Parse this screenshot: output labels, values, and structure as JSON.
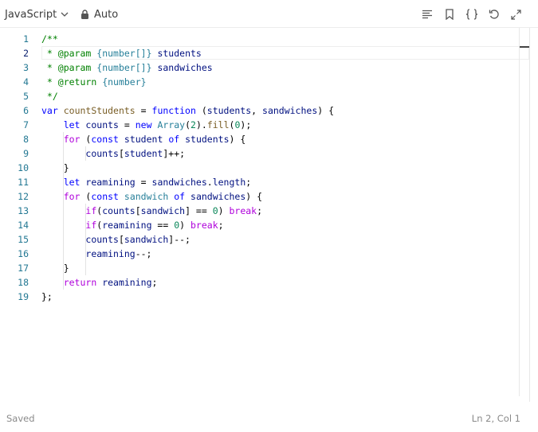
{
  "toolbar": {
    "language": "JavaScript",
    "mode": "Auto",
    "icons": [
      "format-icon",
      "bookmark-icon",
      "braces-icon",
      "reset-icon",
      "expand-icon"
    ]
  },
  "editor": {
    "lines": [
      {
        "n": "1"
      },
      {
        "n": "2"
      },
      {
        "n": "3"
      },
      {
        "n": "4"
      },
      {
        "n": "5"
      },
      {
        "n": "6"
      },
      {
        "n": "7"
      },
      {
        "n": "8"
      },
      {
        "n": "9"
      },
      {
        "n": "10"
      },
      {
        "n": "11"
      },
      {
        "n": "12"
      },
      {
        "n": "13"
      },
      {
        "n": "14"
      },
      {
        "n": "15"
      },
      {
        "n": "16"
      },
      {
        "n": "17"
      },
      {
        "n": "18"
      },
      {
        "n": "19"
      }
    ],
    "code": [
      [
        [
          "c-com",
          "/**"
        ]
      ],
      [
        [
          "c-com",
          " * "
        ],
        [
          "c-tag",
          "@param"
        ],
        [
          "c-op",
          " "
        ],
        [
          "c-type",
          "{number[]}"
        ],
        [
          "c-op",
          " "
        ],
        [
          "c-var",
          "students"
        ]
      ],
      [
        [
          "c-com",
          " * "
        ],
        [
          "c-tag",
          "@param"
        ],
        [
          "c-op",
          " "
        ],
        [
          "c-type",
          "{number[]}"
        ],
        [
          "c-op",
          " "
        ],
        [
          "c-var",
          "sandwiches"
        ]
      ],
      [
        [
          "c-com",
          " * "
        ],
        [
          "c-tag",
          "@return"
        ],
        [
          "c-op",
          " "
        ],
        [
          "c-type",
          "{number}"
        ]
      ],
      [
        [
          "c-com",
          " */"
        ]
      ],
      [
        [
          "c-kw",
          "var"
        ],
        [
          "c-op",
          " "
        ],
        [
          "c-fn",
          "countStudents"
        ],
        [
          "c-op",
          " = "
        ],
        [
          "c-kw",
          "function"
        ],
        [
          "c-op",
          " ("
        ],
        [
          "c-var",
          "students"
        ],
        [
          "c-op",
          ", "
        ],
        [
          "c-var",
          "sandwiches"
        ],
        [
          "c-op",
          ") {"
        ]
      ],
      [
        [
          "c-op",
          "    "
        ],
        [
          "c-kw",
          "let"
        ],
        [
          "c-op",
          " "
        ],
        [
          "c-var",
          "counts"
        ],
        [
          "c-op",
          " = "
        ],
        [
          "c-kw",
          "new"
        ],
        [
          "c-op",
          " "
        ],
        [
          "c-cls",
          "Array"
        ],
        [
          "c-op",
          "("
        ],
        [
          "c-num",
          "2"
        ],
        [
          "c-op",
          ")."
        ],
        [
          "c-fn",
          "fill"
        ],
        [
          "c-op",
          "("
        ],
        [
          "c-num",
          "0"
        ],
        [
          "c-op",
          ");"
        ]
      ],
      [
        [
          "c-op",
          "    "
        ],
        [
          "c-ctl",
          "for"
        ],
        [
          "c-op",
          " ("
        ],
        [
          "c-kw",
          "const"
        ],
        [
          "c-op",
          " "
        ],
        [
          "c-var",
          "student"
        ],
        [
          "c-op",
          " "
        ],
        [
          "c-kw",
          "of"
        ],
        [
          "c-op",
          " "
        ],
        [
          "c-var",
          "students"
        ],
        [
          "c-op",
          ") {"
        ]
      ],
      [
        [
          "c-op",
          "        "
        ],
        [
          "c-var",
          "counts"
        ],
        [
          "c-op",
          "["
        ],
        [
          "c-var",
          "student"
        ],
        [
          "c-op",
          "]++;"
        ]
      ],
      [
        [
          "c-op",
          "    }"
        ]
      ],
      [
        [
          "c-op",
          "    "
        ],
        [
          "c-kw",
          "let"
        ],
        [
          "c-op",
          " "
        ],
        [
          "c-var",
          "reamining"
        ],
        [
          "c-op",
          " = "
        ],
        [
          "c-var",
          "sandwiches"
        ],
        [
          "c-op",
          "."
        ],
        [
          "c-var",
          "length"
        ],
        [
          "c-op",
          ";"
        ]
      ],
      [
        [
          "c-op",
          "    "
        ],
        [
          "c-ctl",
          "for"
        ],
        [
          "c-op",
          " ("
        ],
        [
          "c-kw",
          "const"
        ],
        [
          "c-op",
          " "
        ],
        [
          "c-cls",
          "sandwich"
        ],
        [
          "c-op",
          " "
        ],
        [
          "c-kw",
          "of"
        ],
        [
          "c-op",
          " "
        ],
        [
          "c-var",
          "sandwiches"
        ],
        [
          "c-op",
          ") {"
        ]
      ],
      [
        [
          "c-op",
          "        "
        ],
        [
          "c-ctl",
          "if"
        ],
        [
          "c-op",
          "("
        ],
        [
          "c-var",
          "counts"
        ],
        [
          "c-op",
          "["
        ],
        [
          "c-var",
          "sandwich"
        ],
        [
          "c-op",
          "] == "
        ],
        [
          "c-num",
          "0"
        ],
        [
          "c-op",
          ") "
        ],
        [
          "c-ctl",
          "break"
        ],
        [
          "c-op",
          ";"
        ]
      ],
      [
        [
          "c-op",
          "        "
        ],
        [
          "c-ctl",
          "if"
        ],
        [
          "c-op",
          "("
        ],
        [
          "c-var",
          "reamining"
        ],
        [
          "c-op",
          " == "
        ],
        [
          "c-num",
          "0"
        ],
        [
          "c-op",
          ") "
        ],
        [
          "c-ctl",
          "break"
        ],
        [
          "c-op",
          ";"
        ]
      ],
      [
        [
          "c-op",
          "        "
        ],
        [
          "c-var",
          "counts"
        ],
        [
          "c-op",
          "["
        ],
        [
          "c-var",
          "sandwich"
        ],
        [
          "c-op",
          "]--;"
        ]
      ],
      [
        [
          "c-op",
          "        "
        ],
        [
          "c-var",
          "reamining"
        ],
        [
          "c-op",
          "--;"
        ]
      ],
      [
        [
          "c-op",
          "    }"
        ]
      ],
      [
        [
          "c-op",
          "    "
        ],
        [
          "c-ctl",
          "return"
        ],
        [
          "c-op",
          " "
        ],
        [
          "c-var",
          "reamining"
        ],
        [
          "c-op",
          ";"
        ]
      ],
      [
        [
          "c-op",
          "};"
        ]
      ]
    ],
    "active_line": 2
  },
  "status": {
    "left": "Saved",
    "right": "Ln 2, Col 1"
  }
}
